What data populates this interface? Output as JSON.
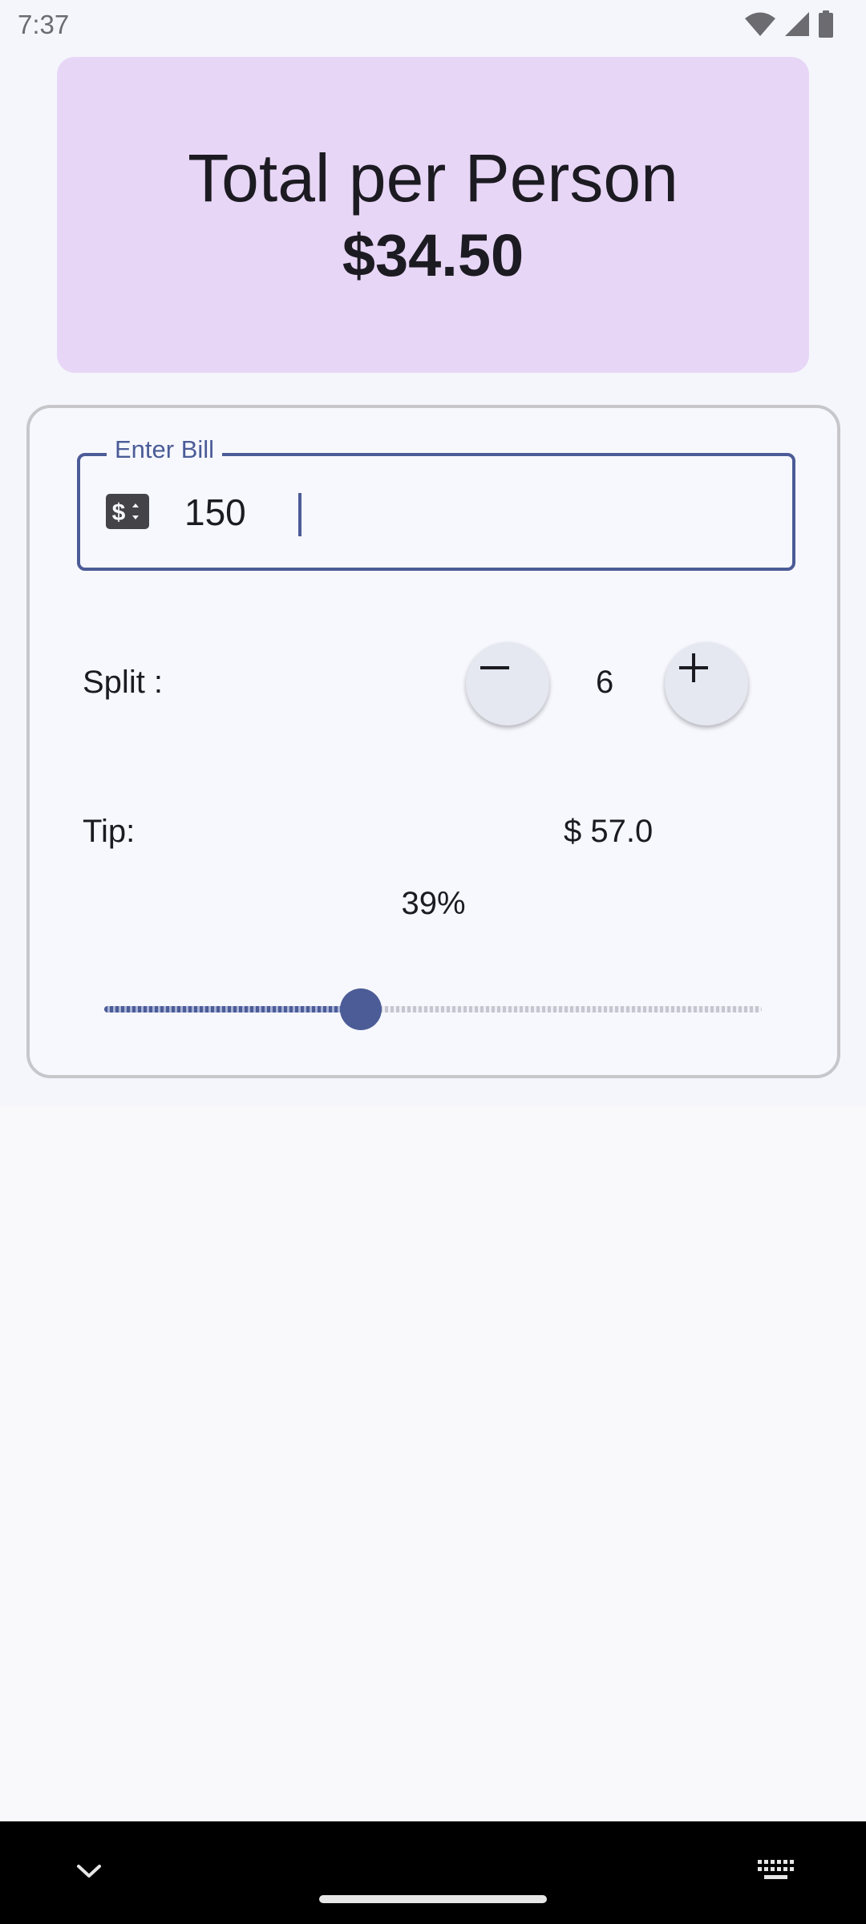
{
  "status_bar": {
    "time": "7:37",
    "icons": [
      "wifi-icon",
      "signal-icon",
      "battery-icon"
    ]
  },
  "summary": {
    "label": "Total per Person",
    "amount": "$34.50"
  },
  "bill": {
    "label": "Enter Bill",
    "value": "150",
    "icon": "dollar-sign-icon"
  },
  "split": {
    "label": "Split :",
    "count": "6",
    "decrement_icon": "minus-icon",
    "increment_icon": "plus-icon"
  },
  "tip": {
    "label": "Tip:",
    "amount": "$ 57.0",
    "percent_label": "39%",
    "slider_fraction": 0.39
  },
  "nav_bar": {
    "icons": [
      "chevron-down-icon",
      "keyboard-icon"
    ]
  },
  "colors": {
    "primary": "#4b5c97",
    "summary_card": "#e8d6f6",
    "app_background": "#f5f6fc",
    "card_border": "#c7c7cb"
  }
}
